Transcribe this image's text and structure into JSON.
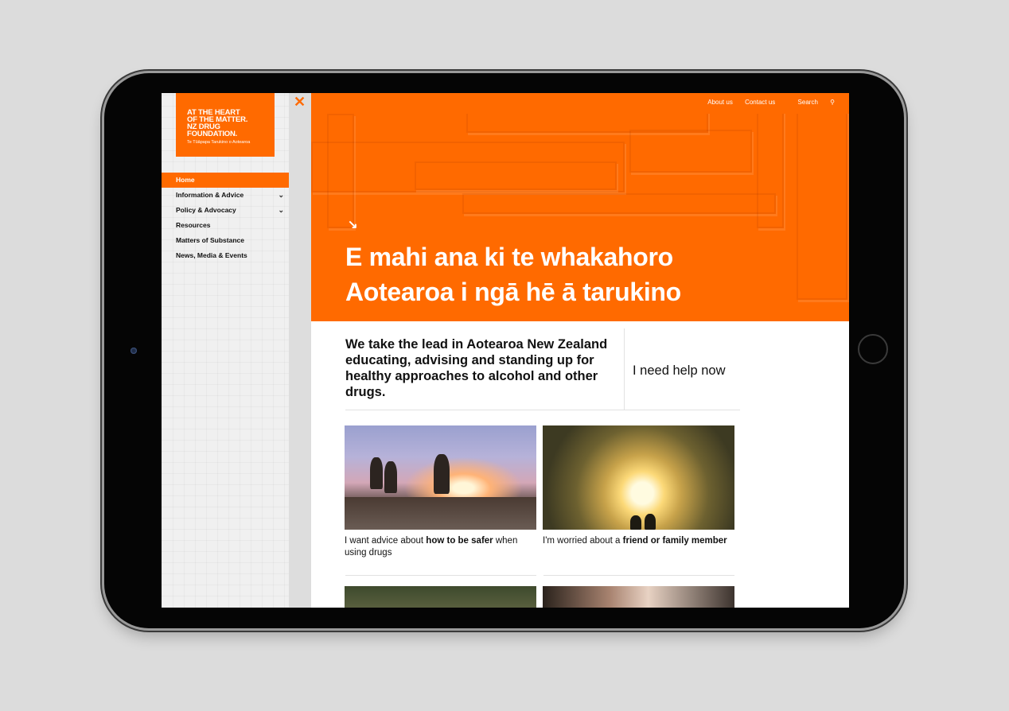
{
  "logo": {
    "lines": [
      "AT THE HEART",
      "OF THE MATTER.",
      "NZ DRUG",
      "FOUNDATION."
    ],
    "tagline": "Te Tūāpapa Tarukino o Aotearoa"
  },
  "sidebar": {
    "items": [
      {
        "label": "Home",
        "active": true
      },
      {
        "label": "Information & Advice",
        "expandable": true
      },
      {
        "label": "Policy & Advocacy",
        "expandable": true
      },
      {
        "label": "Resources"
      },
      {
        "label": "Matters of Substance"
      },
      {
        "label": "News, Media & Events"
      }
    ]
  },
  "topbar": {
    "about": "About us",
    "contact": "Contact us",
    "search": "Search"
  },
  "hero": {
    "line1": "E mahi ana ki te whakahoro",
    "line2": "Aotearoa i ngā hē ā tarukino"
  },
  "intro": {
    "text": "We take the lead in Aotearoa New Zealand educating, advising and standing up for healthy approaches to alcohol and other drugs."
  },
  "help": {
    "label": "I need help now"
  },
  "cards": [
    {
      "pre": "I want advice about ",
      "bold": "how to be safer",
      "post": " when using drugs"
    },
    {
      "pre": "I'm worried about a ",
      "bold": "friend or family member",
      "post": ""
    }
  ],
  "colors": {
    "accent": "#ff6a00"
  }
}
